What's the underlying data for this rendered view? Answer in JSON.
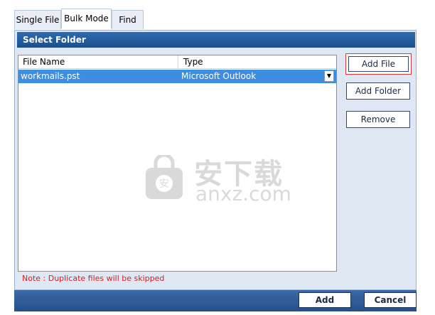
{
  "tabs": [
    {
      "label": "Single File",
      "active": false
    },
    {
      "label": "Bulk Mode",
      "active": true
    },
    {
      "label": "Find",
      "active": false
    }
  ],
  "section": {
    "title": "Select Folder"
  },
  "file_list": {
    "columns": [
      "File Name",
      "Type"
    ],
    "rows": [
      {
        "name": "workmails.pst",
        "type": "Microsoft Outlook",
        "selected": true
      }
    ]
  },
  "side_buttons": {
    "add_file": "Add File",
    "add_folder": "Add Folder",
    "remove": "Remove"
  },
  "note": "Note : Duplicate files will be skipped",
  "watermark": {
    "cn_text": "安下载",
    "en_text": "anxz.com"
  },
  "footer": {
    "add": "Add",
    "cancel": "Cancel"
  },
  "colors": {
    "header_blue": "#1d4f8a",
    "selection_blue": "#3b8ee0",
    "panel_bg": "#dfe7f3",
    "note_red": "#d42020",
    "highlight_border": "#d43b3b"
  }
}
